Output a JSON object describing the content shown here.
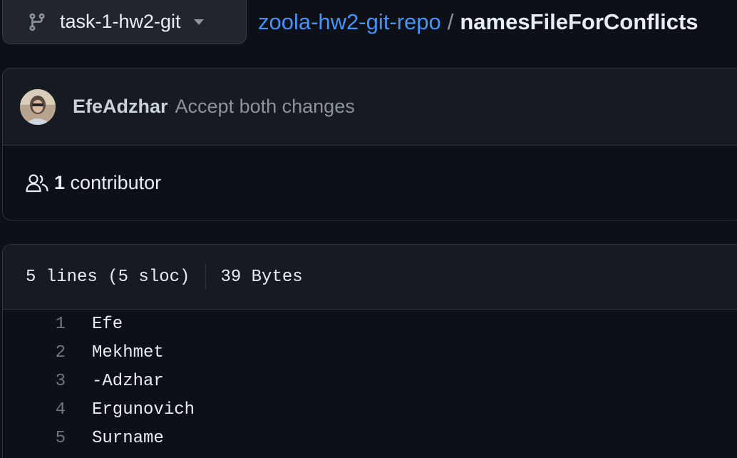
{
  "branch": {
    "name": "task-1-hw2-git",
    "icon": "git-branch-icon"
  },
  "breadcrumb": {
    "repo": "zoola-hw2-git-repo",
    "separator": "/",
    "file": "namesFileForConflicts"
  },
  "commit": {
    "author": "EfeAdzhar",
    "message": "Accept both changes"
  },
  "contributors": {
    "count": "1",
    "label": "contributor",
    "icon": "people-icon"
  },
  "file_info": {
    "lines": "5 lines (5 sloc)",
    "size": "39 Bytes"
  },
  "code": [
    {
      "num": "1",
      "text": "Efe"
    },
    {
      "num": "2",
      "text": "Mekhmet"
    },
    {
      "num": "3",
      "text": "-Adzhar"
    },
    {
      "num": "4",
      "text": "Ergunovich"
    },
    {
      "num": "5",
      "text": "Surname"
    }
  ],
  "colors": {
    "background": "#0d1117",
    "link": "#4493f8",
    "muted": "#8b949e",
    "border": "#30363d"
  }
}
